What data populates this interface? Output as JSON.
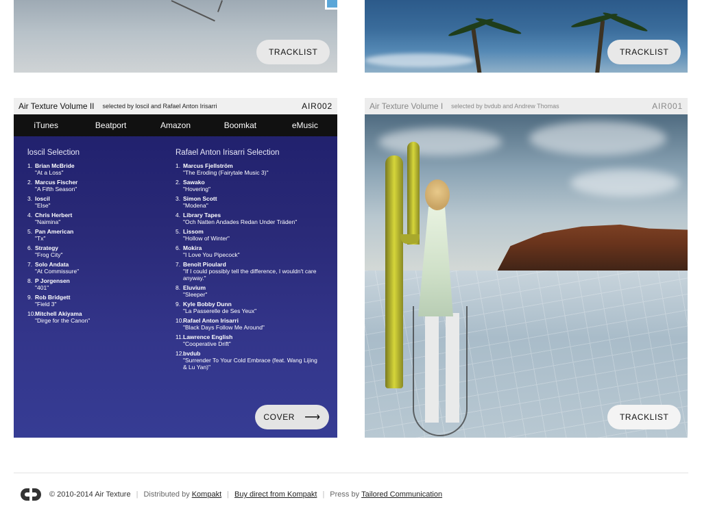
{
  "top_cards": {
    "left": {
      "button_label": "TRACKLIST"
    },
    "right": {
      "button_label": "TRACKLIST"
    }
  },
  "volume2": {
    "title": "Air Texture Volume II",
    "selected_by": "selected by loscil and Rafael Anton Irisarri",
    "catalog": "AIR002",
    "stores": [
      "iTunes",
      "Beatport",
      "Amazon",
      "Boomkat",
      "eMusic"
    ],
    "left_column": {
      "title": "loscil Selection",
      "tracks": [
        {
          "num": "1.",
          "artist": "Brian McBride",
          "title": "\"At a Loss\""
        },
        {
          "num": "2.",
          "artist": "Marcus Fischer",
          "title": "\"A Fifth Season\""
        },
        {
          "num": "3.",
          "artist": "loscil",
          "title": "\"Else\""
        },
        {
          "num": "4.",
          "artist": "Chris Herbert",
          "title": "\"Naimina\""
        },
        {
          "num": "5.",
          "artist": "Pan American",
          "title": "\"Tx\""
        },
        {
          "num": "6.",
          "artist": "Strategy",
          "title": "\"Frog City\""
        },
        {
          "num": "7.",
          "artist": "Solo Andata",
          "title": "\"At Commissure\""
        },
        {
          "num": "8.",
          "artist": "P Jorgensen",
          "title": "\"401\""
        },
        {
          "num": "9.",
          "artist": "Rob Bridgett",
          "title": "\"Field 3\""
        },
        {
          "num": "10.",
          "artist": "Mitchell Akiyama",
          "title": "\"Dirge for the Canon\""
        }
      ]
    },
    "right_column": {
      "title": "Rafael Anton Irisarri Selection",
      "tracks": [
        {
          "num": "1.",
          "artist": "Marcus Fjellström",
          "title": "\"The Eroding (Fairytale Music 3)\""
        },
        {
          "num": "2.",
          "artist": "Sawako",
          "title": "\"Hovering\""
        },
        {
          "num": "3.",
          "artist": "Simon Scott",
          "title": "\"Modena\""
        },
        {
          "num": "4.",
          "artist": "Library Tapes",
          "title": "\"Och Natten Andades Redan Under Träden\""
        },
        {
          "num": "5.",
          "artist": "Lissom",
          "title": "\"Hollow of Winter\""
        },
        {
          "num": "6.",
          "artist": "Mokira",
          "title": "\"I Love You Pipecock\""
        },
        {
          "num": "7.",
          "artist": "Benoît Pioulard",
          "title": "\"If I could possibly tell the difference, I wouldn't care anyway.\""
        },
        {
          "num": "8.",
          "artist": "Eluvium",
          "title": "\"Sleeper\""
        },
        {
          "num": "9.",
          "artist": "Kyle Bobby Dunn",
          "title": "\"La Passerelle de Ses Yeux\""
        },
        {
          "num": "10.",
          "artist": "Rafael Anton Irisarri",
          "title": "\"Black Days Follow Me Around\""
        },
        {
          "num": "11.",
          "artist": "Lawrence English",
          "title": "\"Cooperative Drift\""
        },
        {
          "num": "12.",
          "artist": "bvdub",
          "title": "\"Surrender To Your Cold Embrace (feat. Wang Lijing & Lu Yan)\""
        }
      ]
    },
    "cover_button_label": "COVER",
    "cover_arrow": "⟶"
  },
  "volume1": {
    "title": "Air Texture Volume I",
    "selected_by": "selected by bvdub and Andrew Thomas",
    "catalog": "AIR001",
    "button_label": "TRACKLIST"
  },
  "footer": {
    "copyright": "© 2010-2014 Air Texture",
    "distributed_prefix": "Distributed by",
    "distributed_link": "Kompakt",
    "buy_link": "Buy direct from Kompakt",
    "press_prefix": "Press by",
    "press_link": "Tailored Communication",
    "separator": "|"
  },
  "icons": {
    "logo": "air-texture-logo-icon",
    "arrow": "long-arrow-right-icon"
  }
}
